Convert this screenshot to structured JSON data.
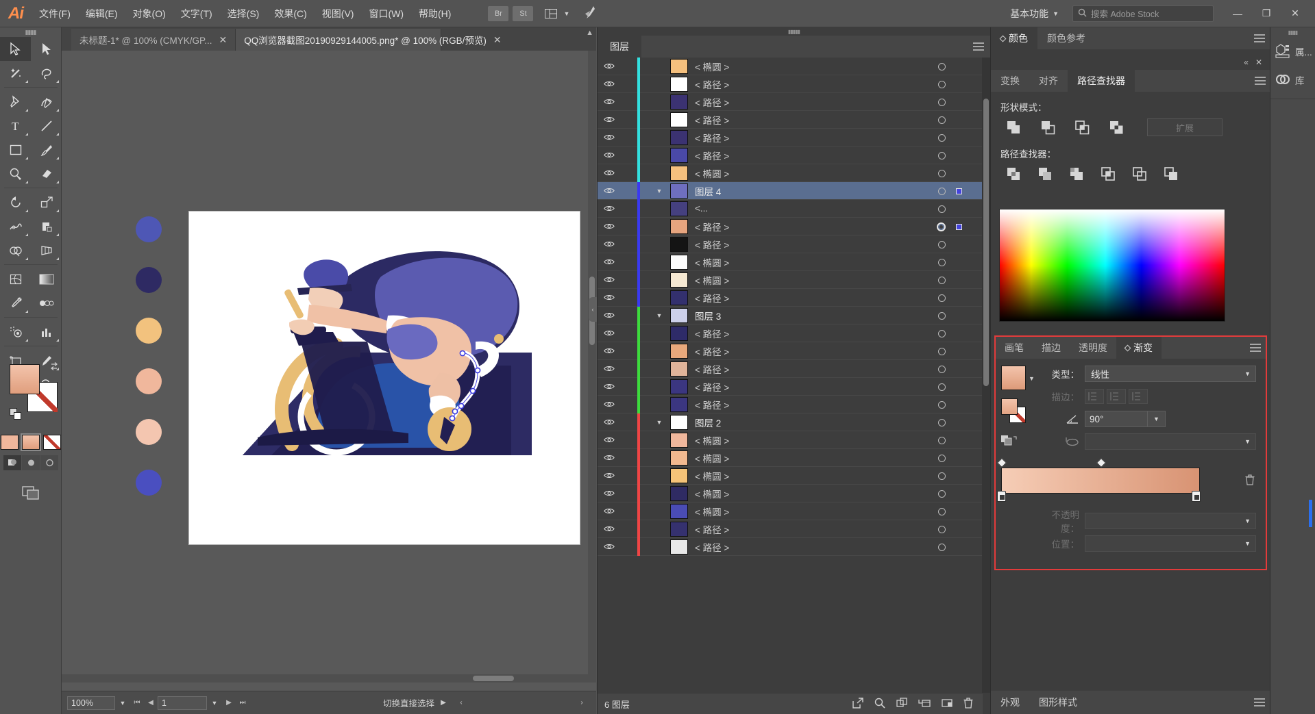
{
  "app": {
    "logo": "Ai",
    "menus": [
      "文件(F)",
      "编辑(E)",
      "对象(O)",
      "文字(T)",
      "选择(S)",
      "效果(C)",
      "视图(V)",
      "窗口(W)",
      "帮助(H)"
    ],
    "bridge_label": "Br",
    "stock_label": "St",
    "workspace": "基本功能",
    "search_placeholder": "搜索 Adobe Stock",
    "window_buttons": {
      "minimize": "—",
      "restore": "❐",
      "close": "✕"
    }
  },
  "tabs": [
    {
      "title": "未标题-1* @ 100% (CMYK/GP...",
      "active": false,
      "close": "✕"
    },
    {
      "title": "QQ浏览器截图20190929144005.png* @ 100% (RGB/预览)",
      "active": true,
      "close": "✕"
    }
  ],
  "tools": [
    {
      "name": "selection-tool",
      "selected": true
    },
    {
      "name": "direct-selection-tool",
      "selected": false
    },
    {
      "name": "magic-wand-tool",
      "selected": false
    },
    {
      "name": "lasso-tool",
      "selected": false
    },
    {
      "name": "pen-tool",
      "selected": false
    },
    {
      "name": "curvature-tool",
      "selected": false
    },
    {
      "name": "type-tool",
      "selected": false
    },
    {
      "name": "line-segment-tool",
      "selected": false
    },
    {
      "name": "rectangle-tool",
      "selected": false
    },
    {
      "name": "paintbrush-tool",
      "selected": false
    },
    {
      "name": "shaper-tool",
      "selected": false
    },
    {
      "name": "eraser-tool",
      "selected": false
    },
    {
      "name": "rotate-tool",
      "selected": false
    },
    {
      "name": "scale-tool",
      "selected": false
    },
    {
      "name": "width-tool",
      "selected": false
    },
    {
      "name": "free-transform-tool",
      "selected": false
    },
    {
      "name": "shape-builder-tool",
      "selected": false
    },
    {
      "name": "perspective-grid-tool",
      "selected": false
    },
    {
      "name": "mesh-tool",
      "selected": false
    },
    {
      "name": "gradient-tool",
      "selected": false
    },
    {
      "name": "eyedropper-tool",
      "selected": false
    },
    {
      "name": "blend-tool",
      "selected": false
    },
    {
      "name": "symbol-sprayer-tool",
      "selected": false
    },
    {
      "name": "column-graph-tool",
      "selected": false
    },
    {
      "name": "artboard-tool",
      "selected": false
    },
    {
      "name": "slice-tool",
      "selected": false
    },
    {
      "name": "hand-tool",
      "selected": false
    },
    {
      "name": "zoom-tool",
      "selected": false
    }
  ],
  "fill_stroke": {
    "fill_color": "#f0bda4",
    "stroke_color": "#ffffff",
    "stroke_none": true
  },
  "canvas": {
    "artboard_background": "#ffffff",
    "palette_dots": [
      "#4e57b5",
      "#2e2a63",
      "#f2c27e",
      "#f0b79c",
      "#f4c6b0",
      "#4a4fc0"
    ]
  },
  "statusbar": {
    "zoom": "100%",
    "page": "1",
    "message": "切换直接选择",
    "first_label": "⏮",
    "prev_label": "◀",
    "next_label": "▶",
    "last_label": "⏭"
  },
  "layers_panel": {
    "tab_label": "图层",
    "footer_count": "6 图层",
    "footer_buttons": [
      "locate-object",
      "make-clipping-mask",
      "create-new-sublayer",
      "create-new-layer",
      "delete-selection"
    ],
    "rows": [
      {
        "name": "< 椭圆 >",
        "type": "object",
        "color": "#33e0e0",
        "thumb": "#f5c07e",
        "indent": 0,
        "selected": false,
        "targeted": false
      },
      {
        "name": "< 路径 >",
        "type": "object",
        "color": "#33e0e0",
        "thumb": "#ffffff",
        "indent": 0,
        "selected": false,
        "targeted": false
      },
      {
        "name": "< 路径 >",
        "type": "object",
        "color": "#33e0e0",
        "thumb": "#3b3272",
        "indent": 0,
        "selected": false,
        "targeted": false
      },
      {
        "name": "< 路径 >",
        "type": "object",
        "color": "#33e0e0",
        "thumb": "#ffffff",
        "indent": 0,
        "selected": false,
        "targeted": false
      },
      {
        "name": "< 路径 >",
        "type": "object",
        "color": "#33e0e0",
        "thumb": "#3b3272",
        "indent": 0,
        "selected": false,
        "targeted": false
      },
      {
        "name": "< 路径 >",
        "type": "object",
        "color": "#33e0e0",
        "thumb": "#4a49a8",
        "indent": 0,
        "selected": false,
        "targeted": false
      },
      {
        "name": "< 椭圆 >",
        "type": "object",
        "color": "#33e0e0",
        "thumb": "#f5c07e",
        "indent": 0,
        "selected": false,
        "targeted": false
      },
      {
        "name": "图层 4",
        "type": "layer",
        "color": "#3a3af0",
        "thumb": "#6e6fc0",
        "indent": 0,
        "selected": true,
        "targeted": false,
        "expanded": true,
        "has_selbox": true
      },
      {
        "name": "<...",
        "type": "object",
        "color": "#3a3af0",
        "thumb": "#45407f",
        "indent": 0,
        "selected": false,
        "targeted": false
      },
      {
        "name": "< 路径 >",
        "type": "object",
        "color": "#3a3af0",
        "thumb": "#e7a57f",
        "indent": 0,
        "selected": false,
        "targeted": true,
        "has_selbox": true
      },
      {
        "name": "< 路径 >",
        "type": "object",
        "color": "#3a3af0",
        "thumb": "#141414",
        "indent": 0,
        "selected": false,
        "targeted": false
      },
      {
        "name": "< 椭圆 >",
        "type": "object",
        "color": "#3a3af0",
        "thumb": "#fbfbfb",
        "indent": 0,
        "selected": false,
        "targeted": false
      },
      {
        "name": "< 椭圆 >",
        "type": "object",
        "color": "#3a3af0",
        "thumb": "#f6e9d3",
        "indent": 0,
        "selected": false,
        "targeted": false
      },
      {
        "name": "< 路径 >",
        "type": "object",
        "color": "#3a3af0",
        "thumb": "#33306e",
        "indent": 0,
        "selected": false,
        "targeted": false
      },
      {
        "name": "图层 3",
        "type": "layer",
        "color": "#3ddb3d",
        "thumb": "#ccd0ea",
        "indent": 0,
        "selected": false,
        "targeted": false,
        "expanded": true
      },
      {
        "name": "< 路径 >",
        "type": "object",
        "color": "#3ddb3d",
        "thumb": "#2e2b68",
        "indent": 0,
        "selected": false,
        "targeted": false
      },
      {
        "name": "< 路径 >",
        "type": "object",
        "color": "#3ddb3d",
        "thumb": "#e8a87c",
        "indent": 0,
        "selected": false,
        "targeted": false
      },
      {
        "name": "< 路径 >",
        "type": "object",
        "color": "#3ddb3d",
        "thumb": "#e0b49a",
        "indent": 0,
        "selected": false,
        "targeted": false
      },
      {
        "name": "< 路径 >",
        "type": "object",
        "color": "#3ddb3d",
        "thumb": "#3b3680",
        "indent": 0,
        "selected": false,
        "targeted": false
      },
      {
        "name": "< 路径 >",
        "type": "object",
        "color": "#3ddb3d",
        "thumb": "#3b3680",
        "indent": 0,
        "selected": false,
        "targeted": false
      },
      {
        "name": "图层 2",
        "type": "layer",
        "color": "#f04545",
        "thumb": "#ffffff",
        "indent": 0,
        "selected": false,
        "targeted": false,
        "expanded": true
      },
      {
        "name": "< 椭圆 >",
        "type": "object",
        "color": "#f04545",
        "thumb": "#f0b79c",
        "indent": 0,
        "selected": false,
        "targeted": false
      },
      {
        "name": "< 椭圆 >",
        "type": "object",
        "color": "#f04545",
        "thumb": "#f2b98f",
        "indent": 0,
        "selected": false,
        "targeted": false
      },
      {
        "name": "< 椭圆 >",
        "type": "object",
        "color": "#f04545",
        "thumb": "#f5c378",
        "indent": 0,
        "selected": false,
        "targeted": false
      },
      {
        "name": "< 椭圆 >",
        "type": "object",
        "color": "#f04545",
        "thumb": "#2f2b63",
        "indent": 0,
        "selected": false,
        "targeted": false
      },
      {
        "name": "< 椭圆 >",
        "type": "object",
        "color": "#f04545",
        "thumb": "#4a4cb5",
        "indent": 0,
        "selected": false,
        "targeted": false
      },
      {
        "name": "< 路径 >",
        "type": "object",
        "color": "#f04545",
        "thumb": "#35316f",
        "indent": 0,
        "selected": false,
        "targeted": false
      },
      {
        "name": "< 路径 >",
        "type": "object",
        "color": "#f04545",
        "thumb": "#e8e8e8",
        "indent": 0,
        "selected": false,
        "targeted": false
      }
    ]
  },
  "color_panel": {
    "tabs": [
      {
        "label": "颜色",
        "active": true,
        "has_diamond": true
      },
      {
        "label": "颜色参考",
        "active": false,
        "has_diamond": false
      }
    ]
  },
  "pathfinder_panel": {
    "collapse_label": "«",
    "close_label": "✕",
    "tabs": [
      {
        "label": "变换",
        "active": false
      },
      {
        "label": "对齐",
        "active": false
      },
      {
        "label": "路径查找器",
        "active": true
      }
    ],
    "shape_modes_label": "形状模式：",
    "pathfinder_label": "路径查找器：",
    "expand_button": "扩展",
    "shape_mode_buttons": [
      "unite",
      "minus-front",
      "intersect",
      "exclude"
    ],
    "pathfinder_buttons": [
      "divide",
      "trim",
      "merge",
      "crop",
      "outline",
      "minus-back"
    ]
  },
  "gradient_panel": {
    "tabs": [
      {
        "label": "画笔",
        "active": false,
        "has_diamond": false
      },
      {
        "label": "描边",
        "active": false,
        "has_diamond": false
      },
      {
        "label": "透明度",
        "active": false,
        "has_diamond": false
      },
      {
        "label": "渐变",
        "active": true,
        "has_diamond": true
      }
    ],
    "type_label": "类型：",
    "type_value": "线性",
    "stroke_label": "描边：",
    "angle_label_icon": "angle-icon",
    "angle_value": "90°",
    "aspect_icon": "aspect-ratio-icon",
    "opacity_label": "不透明度：",
    "opacity_value": "",
    "location_label": "位置：",
    "location_value": "",
    "gradient_start": "#f6cdb6",
    "gradient_end": "#d89373",
    "stop_positions": [
      0,
      50
    ]
  },
  "bottom_tabs": [
    {
      "label": "外观",
      "active": true
    },
    {
      "label": "图形样式",
      "active": false
    }
  ],
  "dock": {
    "items": [
      {
        "label": "属...",
        "icon": "properties-icon"
      },
      {
        "label": "库",
        "icon": "libraries-icon"
      }
    ]
  }
}
